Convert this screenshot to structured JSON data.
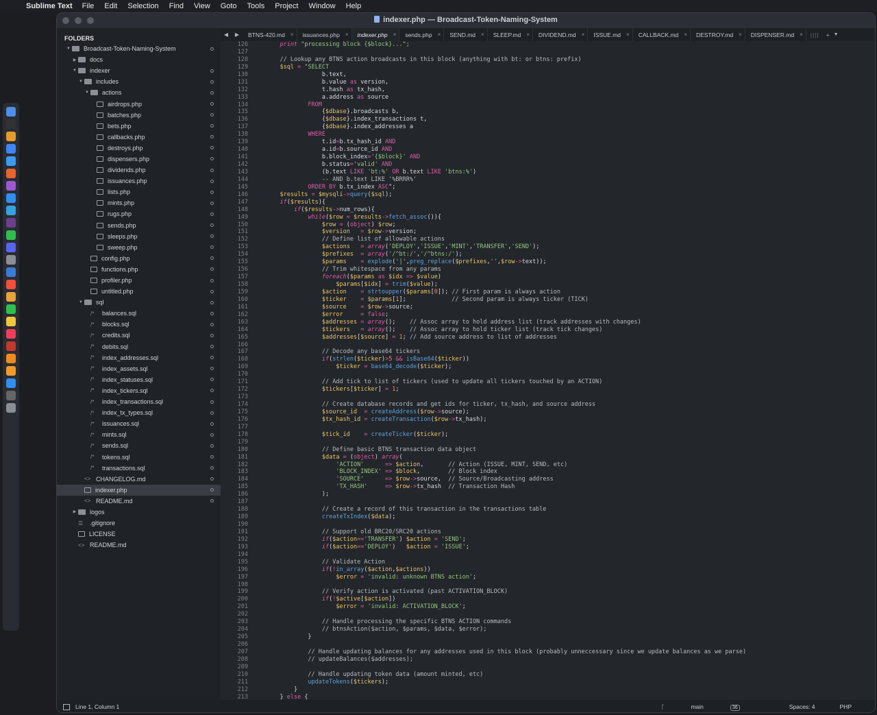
{
  "menubar": {
    "app_name": "Sublime Text",
    "items": [
      "File",
      "Edit",
      "Selection",
      "Find",
      "View",
      "Goto",
      "Tools",
      "Project",
      "Window",
      "Help"
    ]
  },
  "window": {
    "title": "indexer.php — Broadcast-Token-Naming-System"
  },
  "sidebar": {
    "header": "FOLDERS",
    "tree": [
      {
        "label": "Broadcast-Token-Naming-System",
        "depth": 0,
        "kind": "folder",
        "open": true,
        "dot": true
      },
      {
        "label": "docs",
        "depth": 1,
        "kind": "folder",
        "open": false
      },
      {
        "label": "indexer",
        "depth": 1,
        "kind": "folder",
        "open": true,
        "dot": true
      },
      {
        "label": "includes",
        "depth": 2,
        "kind": "folder",
        "open": true,
        "dot": true
      },
      {
        "label": "actions",
        "depth": 3,
        "kind": "folder",
        "open": true,
        "dot": true
      },
      {
        "label": "airdrops.php",
        "depth": 4,
        "kind": "file",
        "dot": true
      },
      {
        "label": "batches.php",
        "depth": 4,
        "kind": "file",
        "dot": true
      },
      {
        "label": "bets.php",
        "depth": 4,
        "kind": "file",
        "dot": true
      },
      {
        "label": "callbacks.php",
        "depth": 4,
        "kind": "file",
        "dot": true
      },
      {
        "label": "destroys.php",
        "depth": 4,
        "kind": "file",
        "dot": true
      },
      {
        "label": "dispensers.php",
        "depth": 4,
        "kind": "file",
        "dot": true
      },
      {
        "label": "dividends.php",
        "depth": 4,
        "kind": "file",
        "dot": true
      },
      {
        "label": "issuances.php",
        "depth": 4,
        "kind": "file",
        "dot": true
      },
      {
        "label": "lists.php",
        "depth": 4,
        "kind": "file",
        "dot": true
      },
      {
        "label": "mints.php",
        "depth": 4,
        "kind": "file",
        "dot": true
      },
      {
        "label": "rugs.php",
        "depth": 4,
        "kind": "file",
        "dot": true
      },
      {
        "label": "sends.php",
        "depth": 4,
        "kind": "file",
        "dot": true
      },
      {
        "label": "sleeps.php",
        "depth": 4,
        "kind": "file",
        "dot": true
      },
      {
        "label": "sweep.php",
        "depth": 4,
        "kind": "file",
        "dot": true
      },
      {
        "label": "config.php",
        "depth": 3,
        "kind": "file",
        "dot": true
      },
      {
        "label": "functions.php",
        "depth": 3,
        "kind": "file",
        "dot": true
      },
      {
        "label": "profiler.php",
        "depth": 3,
        "kind": "file",
        "dot": true
      },
      {
        "label": "untitled.php",
        "depth": 3,
        "kind": "file",
        "dot": true
      },
      {
        "label": "sql",
        "depth": 2,
        "kind": "folder",
        "open": true,
        "dot": true
      },
      {
        "label": "balances.sql",
        "depth": 3,
        "kind": "sql",
        "dot": true
      },
      {
        "label": "blocks.sql",
        "depth": 3,
        "kind": "sql",
        "dot": true
      },
      {
        "label": "credits.sql",
        "depth": 3,
        "kind": "sql",
        "dot": true
      },
      {
        "label": "debits.sql",
        "depth": 3,
        "kind": "sql",
        "dot": true
      },
      {
        "label": "index_addresses.sql",
        "depth": 3,
        "kind": "sql",
        "dot": true
      },
      {
        "label": "index_assets.sql",
        "depth": 3,
        "kind": "sql",
        "dot": true
      },
      {
        "label": "index_statuses.sql",
        "depth": 3,
        "kind": "sql",
        "dot": true
      },
      {
        "label": "index_tickers.sql",
        "depth": 3,
        "kind": "sql",
        "dot": true
      },
      {
        "label": "index_transactions.sql",
        "depth": 3,
        "kind": "sql",
        "dot": true
      },
      {
        "label": "index_tx_types.sql",
        "depth": 3,
        "kind": "sql",
        "dot": true
      },
      {
        "label": "issuances.sql",
        "depth": 3,
        "kind": "sql",
        "dot": true
      },
      {
        "label": "mints.sql",
        "depth": 3,
        "kind": "sql",
        "dot": true
      },
      {
        "label": "sends.sql",
        "depth": 3,
        "kind": "sql",
        "dot": true
      },
      {
        "label": "tokens.sql",
        "depth": 3,
        "kind": "sql",
        "dot": true
      },
      {
        "label": "transactions.sql",
        "depth": 3,
        "kind": "sql",
        "dot": true
      },
      {
        "label": "CHANGELOG.md",
        "depth": 2,
        "kind": "md",
        "dot": true
      },
      {
        "label": "indexer.php",
        "depth": 2,
        "kind": "file",
        "dot": true,
        "active": true
      },
      {
        "label": "README.md",
        "depth": 2,
        "kind": "md",
        "dot": true
      },
      {
        "label": "logos",
        "depth": 1,
        "kind": "folder",
        "open": false
      },
      {
        "label": ".gitignore",
        "depth": 1,
        "kind": "lines"
      },
      {
        "label": "LICENSE",
        "depth": 1,
        "kind": "file"
      },
      {
        "label": "README.md",
        "depth": 1,
        "kind": "md"
      }
    ]
  },
  "tabs": [
    {
      "label": "BTNS-420.md",
      "active": false
    },
    {
      "label": "issuances.php",
      "active": false
    },
    {
      "label": "indexer.php",
      "active": true
    },
    {
      "label": "sends.php",
      "active": false
    },
    {
      "label": "SEND.md",
      "active": false
    },
    {
      "label": "SLEEP.md",
      "active": false
    },
    {
      "label": "DIVIDEND.md",
      "active": false
    },
    {
      "label": "ISSUE.md",
      "active": false
    },
    {
      "label": "CALLBACK.md",
      "active": false
    },
    {
      "label": "DESTROY.md",
      "active": false
    },
    {
      "label": "DISPENSER.md",
      "active": false
    }
  ],
  "editor": {
    "first_line": 126,
    "lines": [
      "    print \"processing block {$block}...\";",
      "",
      "    // Lookup any BTNS action broadcasts in this block (anything with bt: or btns: prefix)",
      "    $sql = \"SELECT",
      "                b.text,",
      "                b.value as version,",
      "                t.hash as tx_hash,",
      "                a.address as source",
      "            FROM",
      "                {$dbase}.broadcasts b,",
      "                {$dbase}.index_transactions t,",
      "                {$dbase}.index_addresses a",
      "            WHERE",
      "                t.id=b.tx_hash_id AND",
      "                a.id=b.source_id AND",
      "                b.block_index='{$block}' AND",
      "                b.status='valid' AND",
      "                (b.text LIKE 'bt:%' OR b.text LIKE 'btns:%')",
      "                -- AND b.text LIKE '%BRRR%'",
      "            ORDER BY b.tx_index ASC\";",
      "    $results = $mysqli->query($sql);",
      "    if($results){",
      "        if($results->num_rows){",
      "            while($row = $results->fetch_assoc()){",
      "                $row = (object) $row;",
      "                $version   = $row->version;",
      "                // Define list of allowable actions",
      "                $actions   = array('DEPLOY','ISSUE','MINT','TRANSFER','SEND');",
      "                $prefixes  = array('/^bt:/','/^btns:/');",
      "                $params    = explode('|',preg_replace($prefixes,'',$row->text));",
      "                // Trim whitespace from any params",
      "                foreach($params as $idx => $value)",
      "                    $params[$idx] = trim($value);",
      "                $action    = strtoupper($params[0]); // First param is always action",
      "                $ticker    = $params[1];             // Second param is always ticker (TICK)",
      "                $source    = $row->source;",
      "                $error     = false;",
      "                $addresses = array();    // Assoc array to hold address list (track addresses with changes)",
      "                $tickers   = array();    // Assoc array to hold ticker list (track tick changes)",
      "                $addresses[$source] = 1; // Add source address to list of addresses",
      "",
      "                // Decode any base64 tickers",
      "                if(strlen($ticker)>5 && isBase64($ticker))",
      "                    $ticker = base64_decode($ticker);",
      "",
      "                // Add tick to list of tickers (used to update all tickers touched by an ACTION)",
      "                $tickers[$ticker] = 1;",
      "",
      "                // Create database records and get ids for ticker, tx_hash, and source address",
      "                $source_id  = createAddress($row->source);",
      "                $tx_hash_id = createTransaction($row->tx_hash);",
      "",
      "                $tick_id    = createTicker($ticker);",
      "",
      "                // Define basic BTNS transaction data object",
      "                $data = (object) array(",
      "                    'ACTION'      => $action,       // Action (ISSUE, MINT, SEND, etc)",
      "                    'BLOCK_INDEX' => $block,        // Block index",
      "                    'SOURCE'      => $row->source,  // Source/Broadcasting address",
      "                    'TX_HASH'     => $row->tx_hash  // Transaction Hash",
      "                );",
      "",
      "                // Create a record of this transaction in the transactions table",
      "                createTxIndex($data);",
      "",
      "                // Support old BRC20/SRC20 actions",
      "                if($action=='TRANSFER') $action = 'SEND';",
      "                if($action=='DEPLOY')   $action = 'ISSUE';",
      "",
      "                // Validate Action",
      "                if(!in_array($action,$actions))",
      "                    $error = 'invalid: unknown BTNS action';",
      "",
      "                // Verify action is activated (past ACTIVATION_BLOCK)",
      "                if(!$active[$action])",
      "                    $error = 'invalid: ACTIVATION_BLOCK';",
      "",
      "                // Handle processing the specific BTNS ACTION commands",
      "                // btnsAction($action, $params, $data, $error);",
      "            }",
      "",
      "            // Handle updating balances for any addresses used in this block (probably unneccessary since we update balances as we parse)",
      "            // updateBalances($addresses);",
      "",
      "            // Handle updating token data (amount minted, etc)",
      "            updateTokens($tickers);",
      "        }",
      "    } else {"
    ]
  },
  "statusbar": {
    "position": "Line 1, Column 1",
    "branch": "main",
    "branch_badge": "36",
    "spaces": "Spaces: 4",
    "syntax": "PHP"
  },
  "colors": {
    "keyword": "#d95fa6",
    "string": "#96c77f",
    "function": "#5ea3dd",
    "variable": "#e9c46a",
    "comment": "#b8bcc2",
    "number": "#f08d5e"
  },
  "dock_icons": [
    "finder-icon",
    "terminal-icon",
    "sublime-icon",
    "chrome-icon",
    "mail-icon",
    "firefox-icon",
    "podcast-icon",
    "safari-icon",
    "telegram-icon",
    "slack-icon",
    "messages-icon",
    "discord-icon",
    "settings-icon",
    "app-icon",
    "calendar-icon",
    "photos-icon",
    "facetime-icon",
    "notes-icon",
    "music-icon",
    "filezilla-icon",
    "vlc-icon",
    "pages-icon",
    "appstore-icon",
    "calculator-icon",
    "trash-icon"
  ]
}
